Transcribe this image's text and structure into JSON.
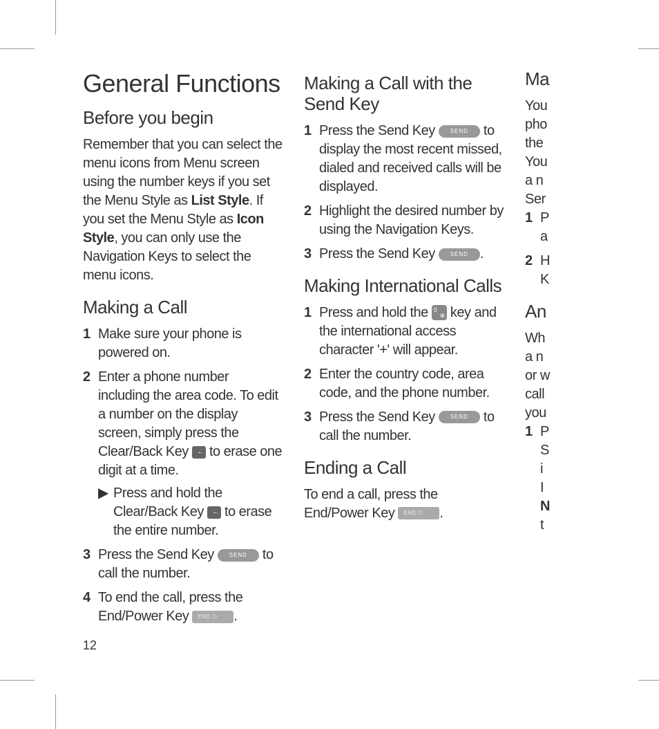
{
  "page_number": "12",
  "title": "General Functions",
  "col1": {
    "h_before": "Before you begin",
    "p_before_1": "Remember that you can select the menu icons from Menu screen using the number keys if you set the Menu Style as ",
    "p_before_bold1": "List Style",
    "p_before_2": ". If you set the Menu Style as ",
    "p_before_bold2": "Icon Style",
    "p_before_3": ", you can only use the Navigation Keys to select the menu icons.",
    "h_making": "Making a Call",
    "li1": "Make sure your phone is powered on.",
    "li2_a": "Enter a phone number including the area code. To edit a number on the display screen, simply press the Clear/Back Key ",
    "li2_b": " to erase one digit at a time.",
    "li2_sub_a": "Press and hold the Clear/Back Key ",
    "li2_sub_b": " to erase the entire number.",
    "li3_a": "Press the Send Key ",
    "li3_b": " to call the number.",
    "li4_a": "To end the call, press the End/Power Key ",
    "li4_b": "."
  },
  "col2": {
    "h_sendkey": "Making a Call with the Send Key",
    "sk_li1_a": "Press the Send Key ",
    "sk_li1_b": " to display the most recent missed, dialed and received calls will be displayed.",
    "sk_li2": "Highlight the desired number by using the Navigation Keys.",
    "sk_li3_a": "Press the Send Key ",
    "sk_li3_b": ".",
    "h_intl": "Making International Calls",
    "intl_li1_a": "Press and hold the ",
    "intl_li1_b": " key and the international access character '+' will appear.",
    "intl_li2": "Enter the country code, area code, and the phone number.",
    "intl_li3_a": "Press the Send Key ",
    "intl_li3_b": " to call the number.",
    "h_ending": "Ending a Call",
    "ending_a": "To end a call, press the End/Power Key ",
    "ending_b": "."
  },
  "col3": {
    "h1": "Ma",
    "p1": "You",
    "p2": "pho",
    "p3": "the",
    "p4": "You",
    "p5": "a n",
    "p6": "Ser",
    "li1a": "P",
    "li1b": "a",
    "li2a": "H",
    "li2b": "K",
    "h2": "An",
    "p7": "Wh",
    "p8": "a n",
    "p9": "or w",
    "p10": "call",
    "p11": "you",
    "li3a": "P",
    "li3b": "S",
    "li3c": "i",
    "li3d": "I",
    "li3e": "N",
    "li3f": "t"
  },
  "keys": {
    "send_label": "SEND",
    "end_label": "END ⏻"
  }
}
